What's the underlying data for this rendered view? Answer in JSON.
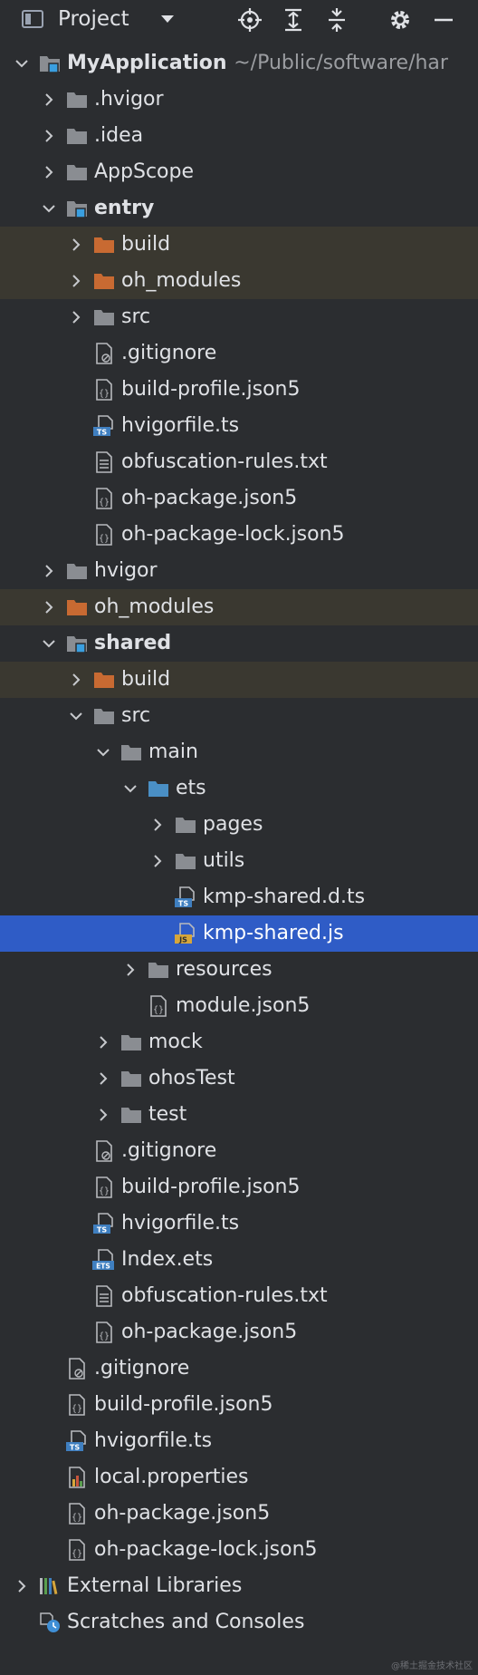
{
  "toolbar": {
    "title": "Project",
    "icons": [
      "locate-icon",
      "expand-all-icon",
      "collapse-all-icon",
      "gear-icon",
      "minimize-icon"
    ]
  },
  "colors": {
    "background": "#2b2d30",
    "selection": "#2f5cc6",
    "excluded_row": "#3a3830",
    "folder": "#8a8d92",
    "excluded_folder": "#c86a32",
    "source_folder": "#4a8fc5"
  },
  "tree": [
    {
      "label": "MyApplication",
      "path": "~/Public/software/har",
      "level": 0,
      "chev": "down",
      "icon": "module",
      "bold": true
    },
    {
      "label": ".hvigor",
      "level": 1,
      "chev": "right",
      "icon": "folder"
    },
    {
      "label": ".idea",
      "level": 1,
      "chev": "right",
      "icon": "folder"
    },
    {
      "label": "AppScope",
      "level": 1,
      "chev": "right",
      "icon": "folder"
    },
    {
      "label": "entry",
      "level": 1,
      "chev": "down",
      "icon": "module",
      "bold": true
    },
    {
      "label": "build",
      "level": 2,
      "chev": "right",
      "icon": "folder-excluded",
      "hl": true
    },
    {
      "label": "oh_modules",
      "level": 2,
      "chev": "right",
      "icon": "folder-excluded",
      "hl": true
    },
    {
      "label": "src",
      "level": 2,
      "chev": "right",
      "icon": "folder"
    },
    {
      "label": ".gitignore",
      "level": 2,
      "icon": "ignore-file"
    },
    {
      "label": "build-profile.json5",
      "level": 2,
      "icon": "json-file"
    },
    {
      "label": "hvigorfile.ts",
      "level": 2,
      "icon": "ts-file"
    },
    {
      "label": "obfuscation-rules.txt",
      "level": 2,
      "icon": "text-file"
    },
    {
      "label": "oh-package.json5",
      "level": 2,
      "icon": "json-file"
    },
    {
      "label": "oh-package-lock.json5",
      "level": 2,
      "icon": "json-file"
    },
    {
      "label": "hvigor",
      "level": 1,
      "chev": "right",
      "icon": "folder"
    },
    {
      "label": "oh_modules",
      "level": 1,
      "chev": "right",
      "icon": "folder-excluded",
      "hl": true
    },
    {
      "label": "shared",
      "level": 1,
      "chev": "down",
      "icon": "module",
      "bold": true
    },
    {
      "label": "build",
      "level": 2,
      "chev": "right",
      "icon": "folder-excluded",
      "hl": true
    },
    {
      "label": "src",
      "level": 2,
      "chev": "down",
      "icon": "folder"
    },
    {
      "label": "main",
      "level": 3,
      "chev": "down",
      "icon": "folder"
    },
    {
      "label": "ets",
      "level": 4,
      "chev": "down",
      "icon": "folder-source"
    },
    {
      "label": "pages",
      "level": 5,
      "chev": "right",
      "icon": "folder"
    },
    {
      "label": "utils",
      "level": 5,
      "chev": "right",
      "icon": "folder"
    },
    {
      "label": "kmp-shared.d.ts",
      "level": 5,
      "icon": "ts-file"
    },
    {
      "label": "kmp-shared.js",
      "level": 5,
      "icon": "js-file",
      "selected": true
    },
    {
      "label": "resources",
      "level": 4,
      "chev": "right",
      "icon": "folder"
    },
    {
      "label": "module.json5",
      "level": 4,
      "icon": "json-file"
    },
    {
      "label": "mock",
      "level": 3,
      "chev": "right",
      "icon": "folder"
    },
    {
      "label": "ohosTest",
      "level": 3,
      "chev": "right",
      "icon": "folder"
    },
    {
      "label": "test",
      "level": 3,
      "chev": "right",
      "icon": "folder"
    },
    {
      "label": ".gitignore",
      "level": 2,
      "icon": "ignore-file"
    },
    {
      "label": "build-profile.json5",
      "level": 2,
      "icon": "json-file"
    },
    {
      "label": "hvigorfile.ts",
      "level": 2,
      "icon": "ts-file"
    },
    {
      "label": "Index.ets",
      "level": 2,
      "icon": "ets-file"
    },
    {
      "label": "obfuscation-rules.txt",
      "level": 2,
      "icon": "text-file"
    },
    {
      "label": "oh-package.json5",
      "level": 2,
      "icon": "json-file"
    },
    {
      "label": ".gitignore",
      "level": 1,
      "icon": "ignore-file"
    },
    {
      "label": "build-profile.json5",
      "level": 1,
      "icon": "json-file"
    },
    {
      "label": "hvigorfile.ts",
      "level": 1,
      "icon": "ts-file"
    },
    {
      "label": "local.properties",
      "level": 1,
      "icon": "properties-file"
    },
    {
      "label": "oh-package.json5",
      "level": 1,
      "icon": "json-file"
    },
    {
      "label": "oh-package-lock.json5",
      "level": 1,
      "icon": "json-file"
    },
    {
      "label": "External Libraries",
      "level": 0,
      "chev": "right",
      "icon": "libraries"
    },
    {
      "label": "Scratches and Consoles",
      "level": 0,
      "icon": "scratches"
    }
  ],
  "watermark": "@稀土掘金技术社区"
}
